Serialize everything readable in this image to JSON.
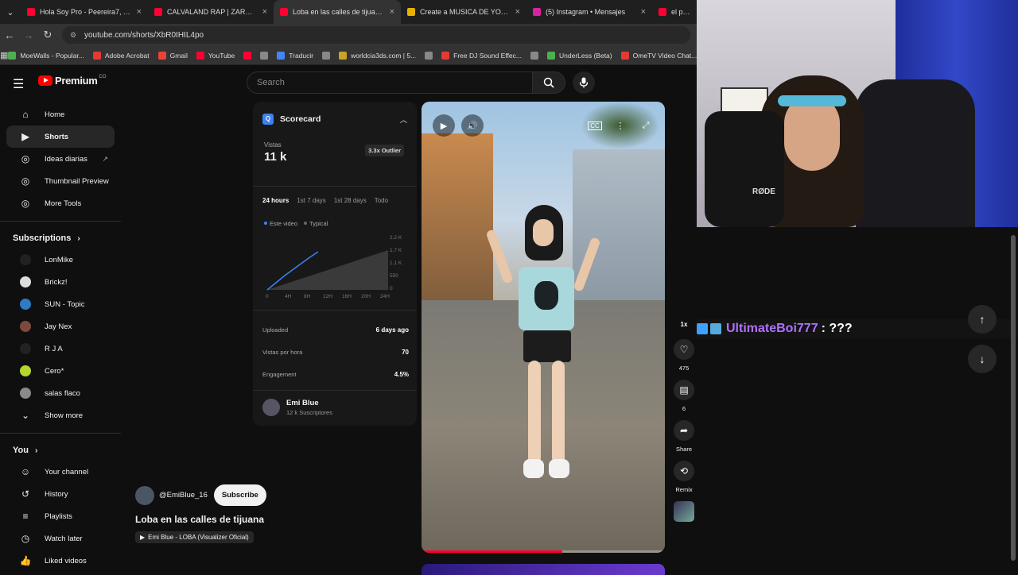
{
  "browser": {
    "tabs": [
      {
        "title": "Hola Soy Pro - Peereira7, Agust",
        "color": "#ff0033",
        "active": false
      },
      {
        "title": "CALVALAND RAP | ZARCORT Y",
        "color": "#ff0033",
        "active": false
      },
      {
        "title": "Loba en las calles de tijuana - Y",
        "color": "#ff0033",
        "active": true
      },
      {
        "title": "Create a MUSICA DE YOUTUBE",
        "color": "#e8b000",
        "active": false
      },
      {
        "title": "(5) Instagram • Mensajes",
        "color": "#d6249f",
        "active": false
      },
      {
        "title": "el pan ket",
        "color": "#ff0033",
        "active": false
      }
    ],
    "url": "youtube.com/shorts/XbR0IHIL4po",
    "bookmarks": [
      {
        "label": "MoeWalls - Popular...",
        "color": "#4caf50"
      },
      {
        "label": "Adobe Acrobat",
        "color": "#e53935"
      },
      {
        "label": "Gmail",
        "color": "#ea4335"
      },
      {
        "label": "YouTube",
        "color": "#ff0033"
      },
      {
        "label": "",
        "color": "#ff0033"
      },
      {
        "label": "",
        "color": "#888888"
      },
      {
        "label": "Traducir",
        "color": "#4285f4"
      },
      {
        "label": "",
        "color": "#888888"
      },
      {
        "label": "worldcia3ds.com | 5...",
        "color": "#c9a227"
      },
      {
        "label": "",
        "color": "#888888"
      },
      {
        "label": "Free DJ Sound Effec...",
        "color": "#e53935"
      },
      {
        "label": "",
        "color": "#888888"
      },
      {
        "label": "UnderLess (Beta)",
        "color": "#4caf50"
      },
      {
        "label": "OmeTV Video Chat...",
        "color": "#e53935"
      }
    ]
  },
  "youtube": {
    "logo_text": "Premium",
    "country": "CO",
    "search_placeholder": "Search",
    "sidebar": {
      "top": [
        {
          "label": "Home",
          "icon": "home-icon",
          "glyph": "⌂",
          "active": false
        },
        {
          "label": "Shorts",
          "icon": "shorts-icon",
          "glyph": "▶",
          "active": true
        },
        {
          "label": "Ideas diarias",
          "icon": "ideas-icon",
          "glyph": "◎",
          "active": false,
          "external": true
        },
        {
          "label": "Thumbnail Preview",
          "icon": "thumbnail-icon",
          "glyph": "◎",
          "active": false
        },
        {
          "label": "More Tools",
          "icon": "tools-icon",
          "glyph": "◎",
          "active": false
        }
      ],
      "subscriptions_title": "Subscriptions",
      "subscriptions": [
        {
          "label": "LonMike",
          "color": "#222222"
        },
        {
          "label": "Brickz!",
          "color": "#dddddd"
        },
        {
          "label": "SUN - Topic",
          "color": "#2e7cc4"
        },
        {
          "label": "Jay Nex",
          "color": "#7a4a3a"
        },
        {
          "label": "R J A",
          "color": "#222222"
        },
        {
          "label": "Cero*",
          "color": "#b5d631"
        },
        {
          "label": "salas flaco",
          "color": "#8a8a8a"
        }
      ],
      "show_more": "Show more",
      "you_title": "You",
      "you_items": [
        {
          "label": "Your channel",
          "glyph": "☺"
        },
        {
          "label": "History",
          "glyph": "↺"
        },
        {
          "label": "Playlists",
          "glyph": "≡"
        },
        {
          "label": "Watch later",
          "glyph": "◷"
        },
        {
          "label": "Liked videos",
          "glyph": "👍"
        }
      ]
    },
    "scorecard": {
      "title": "Scorecard",
      "views_label": "Vistas",
      "views_value": "11 k",
      "outlier": "3.3x Outlier",
      "ranges": [
        "24 hours",
        "1st 7 days",
        "1st 28 days",
        "Todo"
      ],
      "legend_this": "Este video",
      "legend_typical": "Typical",
      "y_ticks": [
        "2.2 K",
        "1.7 K",
        "1.1 K",
        "550",
        "0"
      ],
      "x_ticks": [
        "0",
        "4H",
        "8H",
        "12H",
        "16H",
        "20H",
        "24H"
      ],
      "uploaded_label": "Uploaded",
      "uploaded_value": "6 days ago",
      "vph_label": "Vistas por hora",
      "vph_value": "70",
      "engagement_label": "Engagement",
      "engagement_value": "4.5%",
      "channel_name": "Emi Blue",
      "channel_subs": "12 k Suscriptores"
    },
    "short": {
      "progress": 0.58,
      "speed": "1x",
      "likes": "475",
      "comments": "6",
      "share_label": "Share",
      "remix_label": "Remix",
      "handle": "@EmiBlue_16",
      "subscribe_label": "Subscribe",
      "title": "Loba en las calles de tijuana",
      "music": "Emi Blue - LOBA (Visualizer Oficial)"
    }
  },
  "stream": {
    "mic_brand": "RØDE",
    "chat_user": "UltimateBoi777",
    "chat_message": ": ???"
  }
}
